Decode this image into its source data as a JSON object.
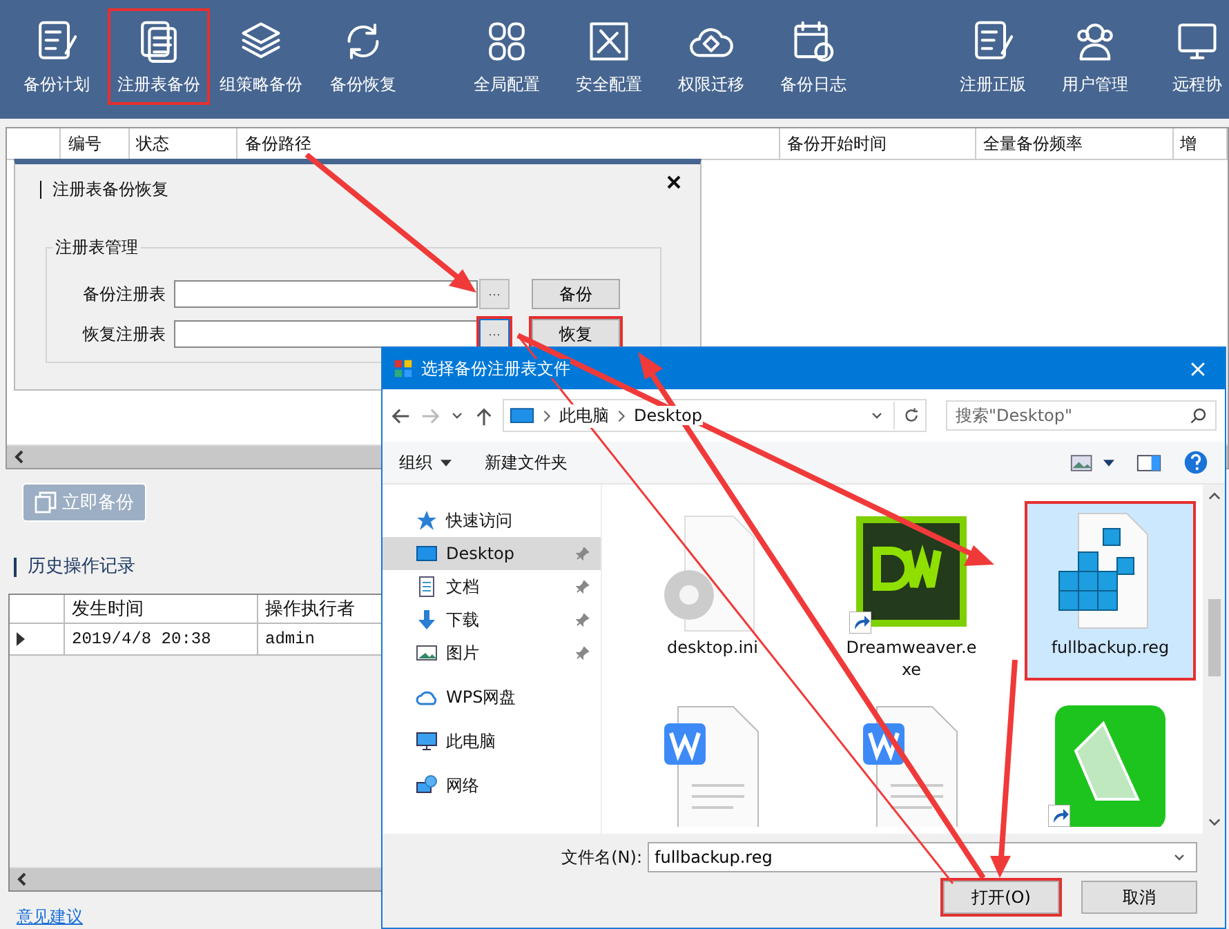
{
  "toolbar": {
    "groups": [
      [
        {
          "kind": "checklist",
          "label": "备份计划",
          "highlighted": false
        },
        {
          "kind": "document",
          "label": "注册表备份",
          "highlighted": true
        },
        {
          "kind": "layers",
          "label": "组策略备份",
          "highlighted": false
        },
        {
          "kind": "refresh",
          "label": "备份恢复",
          "highlighted": false
        }
      ],
      [
        {
          "kind": "grid",
          "label": "全局配置",
          "highlighted": false
        },
        {
          "kind": "tools",
          "label": "安全配置",
          "highlighted": false
        },
        {
          "kind": "cloud",
          "label": "权限迁移",
          "highlighted": false
        },
        {
          "kind": "calendar",
          "label": "备份日志",
          "highlighted": false
        }
      ],
      [
        {
          "kind": "checklist",
          "label": "注册正版",
          "highlighted": false
        },
        {
          "kind": "users",
          "label": "用户管理",
          "highlighted": false
        },
        {
          "kind": "monitor",
          "label": "远程协",
          "highlighted": false
        }
      ]
    ]
  },
  "task_table": {
    "columns": [
      "编号",
      "状态",
      "备份路径",
      "备份开始时间",
      "全量备份频率",
      "增"
    ]
  },
  "restore_panel": {
    "title": "注册表备份恢复",
    "group_title": "注册表管理",
    "rows": [
      {
        "label": "备份注册表",
        "browse": "···",
        "button": "备份",
        "highlighted": false
      },
      {
        "label": "恢复注册表",
        "browse": "···",
        "button": "恢复",
        "highlighted": true
      }
    ]
  },
  "backup_now": "立即备份",
  "history": {
    "title": "历史操作记录",
    "columns": [
      "发生时间",
      "操作执行者"
    ],
    "rows": [
      {
        "cells": [
          "2019/4/8 20:38",
          "admin"
        ],
        "current": true
      }
    ]
  },
  "feedback_link": "意见建议",
  "file_dialog": {
    "title": "选择备份注册表文件",
    "path": [
      "此电脑",
      "Desktop"
    ],
    "search": {
      "placeholder": "搜索\"Desktop\""
    },
    "commands": [
      "组织",
      "新建文件夹"
    ],
    "nav": [
      {
        "kind": "star",
        "label": "快速访问",
        "pinned": false,
        "selected": false
      },
      {
        "kind": "desktop",
        "label": "Desktop",
        "pinned": true,
        "selected": true
      },
      {
        "kind": "document",
        "label": "文档",
        "pinned": true,
        "selected": false
      },
      {
        "kind": "download",
        "label": "下载",
        "pinned": true,
        "selected": false
      },
      {
        "kind": "picture",
        "label": "图片",
        "pinned": true,
        "selected": false
      },
      {
        "kind": "cloud",
        "label": "WPS网盘",
        "pinned": false,
        "selected": false
      },
      {
        "kind": "computer",
        "label": "此电脑",
        "pinned": false,
        "selected": false
      },
      {
        "kind": "network",
        "label": "网络",
        "pinned": false,
        "selected": false
      }
    ],
    "files": [
      {
        "kind": "settings",
        "name": "desktop.ini",
        "shortcut": false,
        "selected": false,
        "highlighted": false
      },
      {
        "kind": "dreamweaver",
        "name": "Dreamweaver.exe",
        "shortcut": true,
        "selected": false,
        "highlighted": false
      },
      {
        "kind": "registry",
        "name": "fullbackup.reg",
        "shortcut": false,
        "selected": true,
        "highlighted": true
      },
      {
        "kind": "word",
        "shortcut": false,
        "selected": false,
        "highlighted": false
      },
      {
        "kind": "word",
        "shortcut": false,
        "selected": false,
        "highlighted": false
      },
      {
        "kind": "video",
        "shortcut": true,
        "selected": false,
        "highlighted": false
      }
    ],
    "filename_label": "文件名(N):",
    "filename": "fullbackup.reg",
    "buttons": [
      {
        "label": "打开(O)",
        "highlighted": true
      },
      {
        "label": "取消",
        "highlighted": false
      }
    ]
  }
}
